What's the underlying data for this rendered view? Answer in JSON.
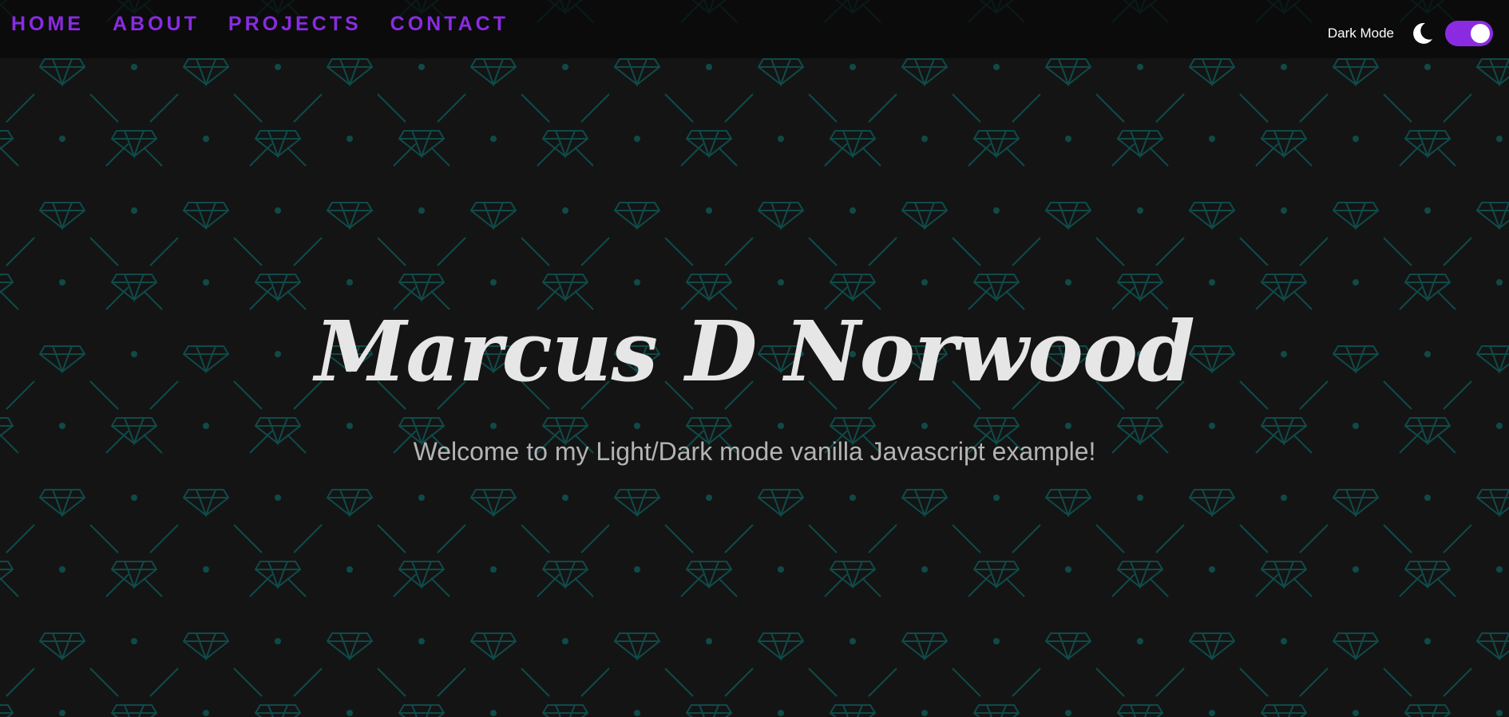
{
  "nav": {
    "links": [
      {
        "label": "HOME"
      },
      {
        "label": "ABOUT"
      },
      {
        "label": "PROJECTS"
      },
      {
        "label": "CONTACT"
      }
    ]
  },
  "theme_toggle": {
    "label": "Dark Mode",
    "icon": "moon-icon",
    "checked": true
  },
  "hero": {
    "title": "Marcus D Norwood",
    "subtitle": "Welcome to my Light/Dark mode vanilla Javascript example!"
  },
  "colors": {
    "background": "#141414",
    "accent": "#8a2be2",
    "pattern": "#0f4a4a",
    "title": "#e6e6e6",
    "subtitle": "#b4b4b4"
  }
}
